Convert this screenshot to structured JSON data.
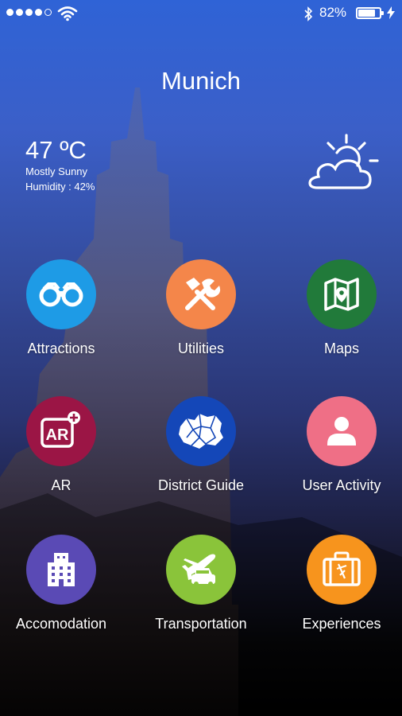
{
  "status_bar": {
    "signal_dots_filled": 4,
    "signal_dots_total": 5,
    "battery_percent": "82%",
    "battery_level": 0.82,
    "icons": [
      "signal-icon",
      "wifi-icon",
      "bluetooth-icon",
      "battery-icon",
      "charging-icon"
    ]
  },
  "city": "Munich",
  "weather": {
    "temperature": "47 ºC",
    "condition": "Mostly Sunny",
    "humidity": "Humidity : 42%",
    "icon": "partly-sunny-icon"
  },
  "menu": [
    {
      "label": "Attractions",
      "icon": "binoculars-icon",
      "color": "#1e9be6"
    },
    {
      "label": "Utilities",
      "icon": "tools-icon",
      "color": "#f4864a"
    },
    {
      "label": "Maps",
      "icon": "map-icon",
      "color": "#217a3a"
    },
    {
      "label": "AR",
      "icon": "ar-icon",
      "color": "#9b1545"
    },
    {
      "label": "District Guide",
      "icon": "district-map-icon",
      "color": "#1447b8"
    },
    {
      "label": "User Activity",
      "icon": "user-icon",
      "color": "#ef6f86"
    },
    {
      "label": "Accomodation",
      "icon": "building-icon",
      "color": "#5a4ab5"
    },
    {
      "label": "Transportation",
      "icon": "plane-car-icon",
      "color": "#8ac43a"
    },
    {
      "label": "Experiences",
      "icon": "suitcase-icon",
      "color": "#f7941d"
    }
  ]
}
